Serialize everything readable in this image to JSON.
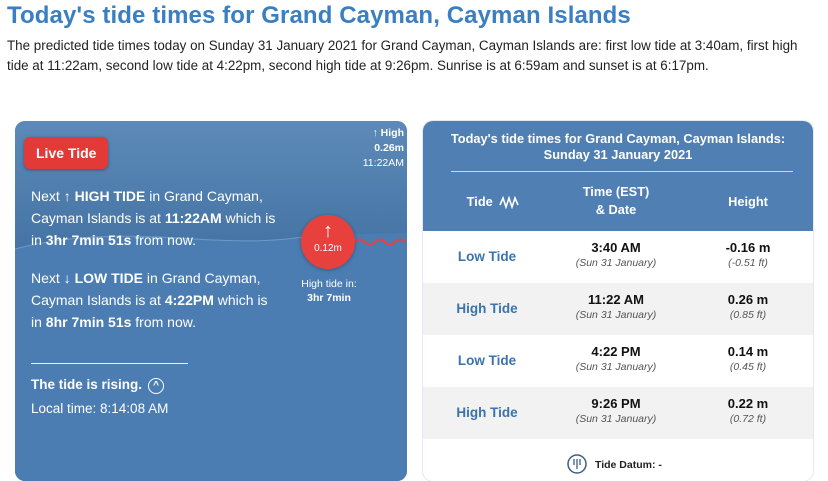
{
  "header": {
    "title": "Today's tide times for Grand Cayman, Cayman Islands",
    "intro": "The predicted tide times today on Sunday 31 January 2021 for Grand Cayman, Cayman Islands are: first low tide at 3:40am, first high tide at 11:22am, second low tide at 4:22pm, second high tide at 9:26pm. Sunrise is at 6:59am and sunset is at 6:17pm."
  },
  "live": {
    "badge": "Live Tide",
    "next_high": {
      "prefix": "Next",
      "arrow": "↑",
      "label": "HIGH TIDE",
      "mid": "in Grand Cayman, Cayman Islands is at",
      "time": "11:22AM",
      "mid2": "which is in",
      "countdown": "3hr 7min 51s",
      "suffix": "from now."
    },
    "next_low": {
      "prefix": "Next",
      "arrow": "↓",
      "label": "LOW TIDE",
      "mid": "in Grand Cayman, Cayman Islands is at",
      "time": "4:22PM",
      "mid2": "which is in",
      "countdown": "8hr 7min 51s",
      "suffix": "from now."
    },
    "timeline_high": {
      "arrow": "↑",
      "label": "High",
      "height": "0.26m",
      "time": "11:22AM"
    },
    "current": {
      "arrow": "↑",
      "height": "0.12m"
    },
    "high_tide_in": {
      "label": "High tide in:",
      "value": "3hr 7min"
    },
    "status": "The tide is rising.",
    "local_time": "Local time: 8:14:08 AM"
  },
  "table": {
    "title_line1": "Today's tide times for Grand Cayman, Cayman Islands:",
    "title_line2": "Sunday 31 January 2021",
    "col_tide": "Tide",
    "col_time_line1": "Time (EST)",
    "col_time_line2": "& Date",
    "col_height": "Height",
    "rows": [
      {
        "type": "Low Tide",
        "time": "3:40 AM",
        "date": "(Sun 31 January)",
        "height_m": "-0.16 m",
        "height_ft": "(-0.51 ft)"
      },
      {
        "type": "High Tide",
        "time": "11:22 AM",
        "date": "(Sun 31 January)",
        "height_m": "0.26 m",
        "height_ft": "(0.85 ft)"
      },
      {
        "type": "Low Tide",
        "time": "4:22 PM",
        "date": "(Sun 31 January)",
        "height_m": "0.14 m",
        "height_ft": "(0.45 ft)"
      },
      {
        "type": "High Tide",
        "time": "9:26 PM",
        "date": "(Sun 31 January)",
        "height_m": "0.22 m",
        "height_ft": "(0.72 ft)"
      }
    ],
    "datum_label": "Tide Datum: -"
  },
  "colors": {
    "title": "#3a7fc1",
    "panel": "#4f7fb3",
    "badge": "#e23a36",
    "tide_type": "#3a73ad"
  }
}
